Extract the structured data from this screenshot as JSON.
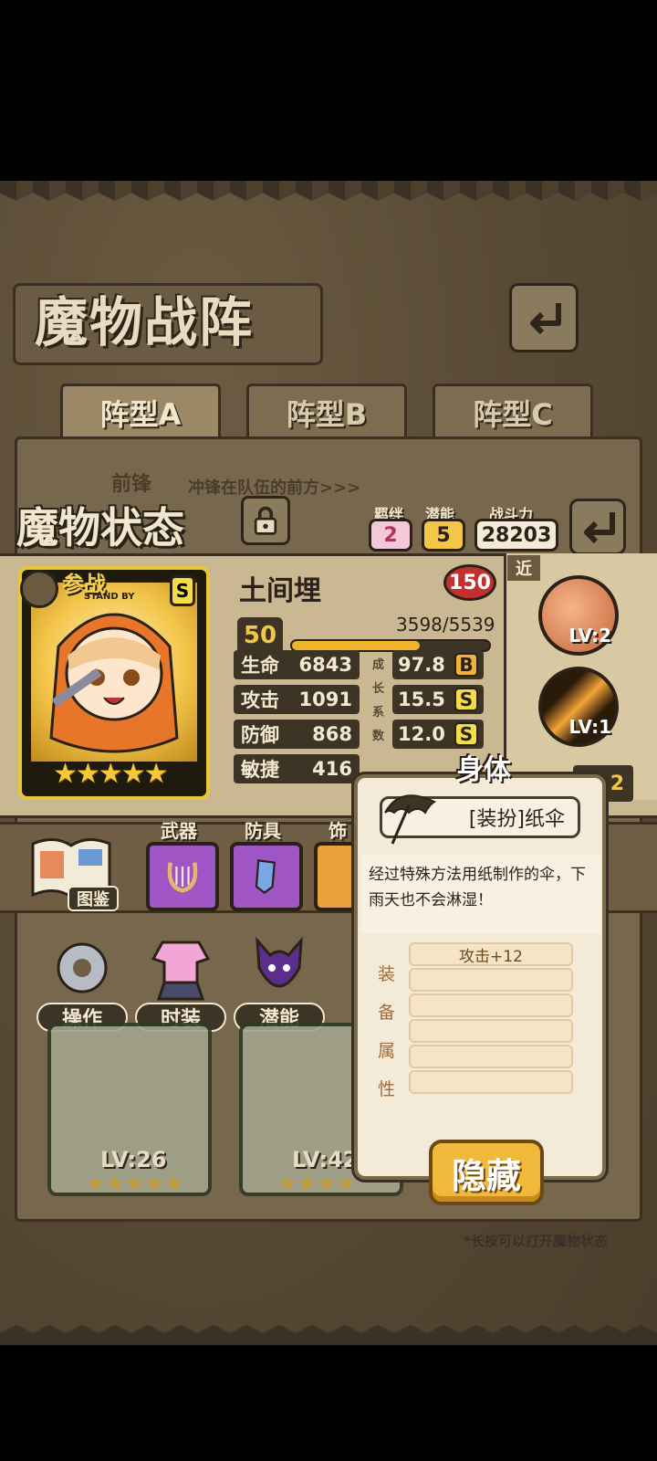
{
  "header": {
    "title": "魔物战阵"
  },
  "tabs": [
    {
      "label": "阵型A"
    },
    {
      "label": "阵型B"
    },
    {
      "label": "阵型C"
    }
  ],
  "formation": {
    "position": "前锋",
    "position_desc": "冲锋在队伍的前方>>>"
  },
  "status": {
    "title": "魔物状态",
    "bond_label": "羁绊",
    "bond_value": "2",
    "potential_label": "潜能",
    "potential_value": "5",
    "power_label": "战斗力",
    "power_value": "28203"
  },
  "character": {
    "standby": "参战",
    "standby_sub": "STAND BY",
    "name": "土间埋",
    "badge_value": "150",
    "level": "50",
    "exp": "3598/5539",
    "exp_fraction": 0.65,
    "stars": "★★★★★",
    "stats": [
      {
        "label": "生命",
        "value": "6843"
      },
      {
        "label": "攻击",
        "value": "1091"
      },
      {
        "label": "防御",
        "value": "868"
      },
      {
        "label": "敏捷",
        "value": "416"
      }
    ],
    "growth_label": "成长系数",
    "growth": [
      {
        "value": "97.8",
        "grade": "B"
      },
      {
        "value": "15.5",
        "grade": "S"
      },
      {
        "value": "12.0",
        "grade": "S"
      }
    ]
  },
  "skills": {
    "range_tag": "近",
    "items": [
      {
        "level": "LV:2"
      },
      {
        "level": "LV:1"
      }
    ],
    "partial_value": "2"
  },
  "equipment": {
    "book_label": "图鉴",
    "slots": [
      {
        "label": "武器"
      },
      {
        "label": "防具"
      },
      {
        "label": "饰"
      }
    ]
  },
  "menu": [
    {
      "label": "操作"
    },
    {
      "label": "时装"
    },
    {
      "label": "潜能"
    }
  ],
  "monsters": [
    {
      "level": "LV:26",
      "stars": "★★★★★"
    },
    {
      "level": "LV:42",
      "stars": "★★★★"
    }
  ],
  "footnote": "*长按可以打开魔物状态",
  "popup": {
    "slot": "身体",
    "item_name": "[装扮]纸伞",
    "description": "经过特殊方法用纸制作的伞，下雨天也不会淋湿！",
    "attr_label_chars": [
      "装",
      "备",
      "属",
      "性"
    ],
    "attributes": [
      "攻击+12",
      "",
      "",
      "",
      "",
      ""
    ],
    "hide_button": "隐藏"
  }
}
